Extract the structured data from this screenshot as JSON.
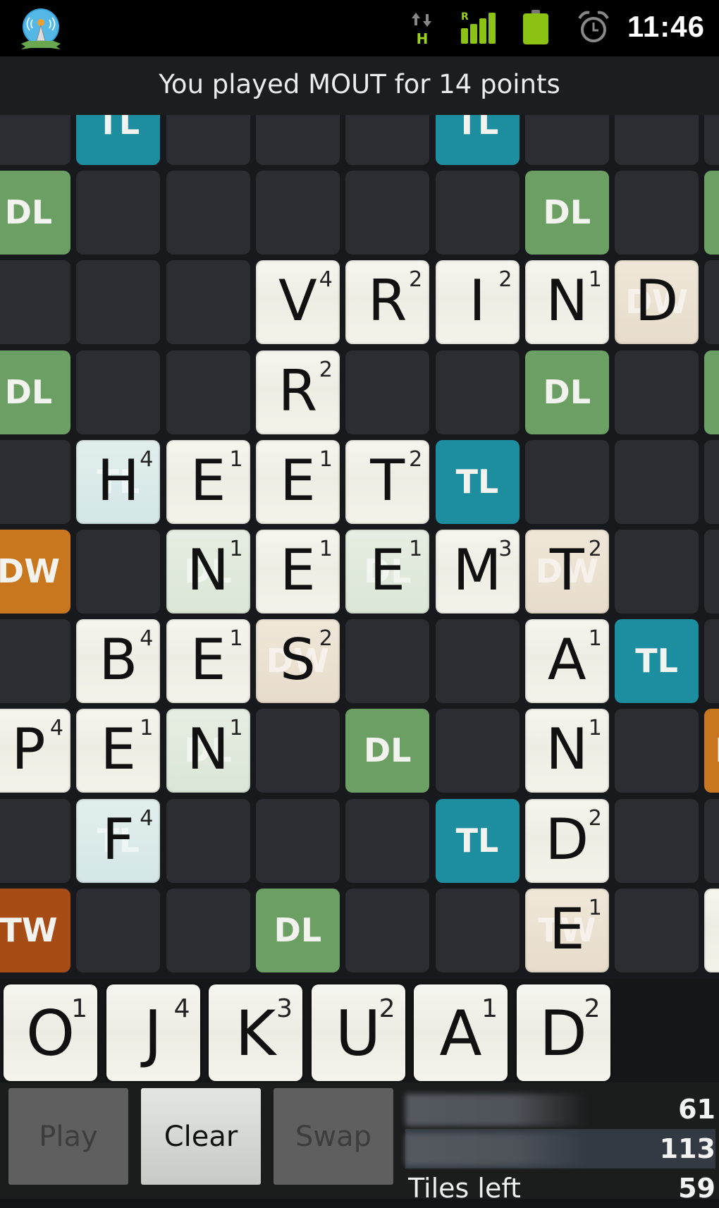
{
  "status_bar": {
    "app_icon": "wifi-tower-pro-icon",
    "network": {
      "icon": "data-arrows-icon",
      "type": "H"
    },
    "signal": {
      "icon": "signal-bars-icon",
      "roaming": "R",
      "level": 4,
      "max": 4
    },
    "battery": {
      "icon": "battery-icon",
      "level_percent": 100
    },
    "alarm_icon": "alarm-clock-icon",
    "time": "11:46"
  },
  "banner": {
    "message": "You played MOUT for 14 points"
  },
  "colors": {
    "TL": "#1c8ea0",
    "DL": "#6c9f63",
    "DW": "#c8771e",
    "TW": "#a84c16",
    "empty": "#2b2d33",
    "tile": "#f3f3eb"
  },
  "board": {
    "visible_rows": 10,
    "visible_cols": 9,
    "rows": [
      [
        {
          "p": ""
        },
        {
          "p": "TL"
        },
        {
          "p": ""
        },
        {
          "p": ""
        },
        {
          "p": ""
        },
        {
          "p": "TL"
        },
        {
          "p": ""
        },
        {
          "p": ""
        },
        {
          "p": ""
        }
      ],
      [
        {
          "p": "DL"
        },
        {
          "p": ""
        },
        {
          "p": ""
        },
        {
          "p": ""
        },
        {
          "p": ""
        },
        {
          "p": ""
        },
        {
          "p": "DL"
        },
        {
          "p": ""
        },
        {
          "p": "DL"
        }
      ],
      [
        {
          "p": ""
        },
        {
          "p": ""
        },
        {
          "p": ""
        },
        {
          "p": "",
          "l": "V",
          "s": "4"
        },
        {
          "p": "",
          "l": "R",
          "s": "2"
        },
        {
          "p": "",
          "l": "I",
          "s": "2"
        },
        {
          "p": "",
          "l": "N",
          "s": "1"
        },
        {
          "p": "DW",
          "l": "D",
          "s": ""
        },
        {
          "p": ""
        }
      ],
      [
        {
          "p": "DL"
        },
        {
          "p": ""
        },
        {
          "p": ""
        },
        {
          "p": "",
          "l": "R",
          "s": "2"
        },
        {
          "p": ""
        },
        {
          "p": ""
        },
        {
          "p": "DL"
        },
        {
          "p": ""
        },
        {
          "p": "DL"
        }
      ],
      [
        {
          "p": ""
        },
        {
          "p": "TL",
          "l": "H",
          "s": "4"
        },
        {
          "p": "",
          "l": "E",
          "s": "1"
        },
        {
          "p": "",
          "l": "E",
          "s": "1"
        },
        {
          "p": "",
          "l": "T",
          "s": "2"
        },
        {
          "p": "TL"
        },
        {
          "p": ""
        },
        {
          "p": ""
        },
        {
          "p": ""
        }
      ],
      [
        {
          "p": "DW"
        },
        {
          "p": ""
        },
        {
          "p": "DL",
          "l": "N",
          "s": "1"
        },
        {
          "p": "",
          "l": "E",
          "s": "1"
        },
        {
          "p": "DL",
          "l": "E",
          "s": "1"
        },
        {
          "p": "",
          "l": "M",
          "s": "3"
        },
        {
          "p": "DW",
          "l": "T",
          "s": "2"
        },
        {
          "p": ""
        },
        {
          "p": ""
        }
      ],
      [
        {
          "p": ""
        },
        {
          "p": "",
          "l": "B",
          "s": "4"
        },
        {
          "p": "",
          "l": "E",
          "s": "1"
        },
        {
          "p": "DW",
          "l": "S",
          "s": "2"
        },
        {
          "p": ""
        },
        {
          "p": ""
        },
        {
          "p": "",
          "l": "A",
          "s": "1"
        },
        {
          "p": "TL"
        },
        {
          "p": ""
        }
      ],
      [
        {
          "p": "",
          "l": "P",
          "s": "4"
        },
        {
          "p": "",
          "l": "E",
          "s": "1"
        },
        {
          "p": "DL",
          "l": "N",
          "s": "1"
        },
        {
          "p": ""
        },
        {
          "p": "DL"
        },
        {
          "p": ""
        },
        {
          "p": "",
          "l": "N",
          "s": "1"
        },
        {
          "p": ""
        },
        {
          "p": "DW"
        }
      ],
      [
        {
          "p": ""
        },
        {
          "p": "TL",
          "l": "F",
          "s": "4"
        },
        {
          "p": ""
        },
        {
          "p": ""
        },
        {
          "p": ""
        },
        {
          "p": "TL"
        },
        {
          "p": "",
          "l": "D",
          "s": "2"
        },
        {
          "p": ""
        },
        {
          "p": ""
        }
      ],
      [
        {
          "p": "TW"
        },
        {
          "p": ""
        },
        {
          "p": ""
        },
        {
          "p": "DL"
        },
        {
          "p": ""
        },
        {
          "p": ""
        },
        {
          "p": "TW",
          "l": "E",
          "s": "1"
        },
        {
          "p": ""
        },
        {
          "p": "",
          "l": "",
          "s": ""
        }
      ]
    ]
  },
  "rack": [
    {
      "letter": "O",
      "score": "1"
    },
    {
      "letter": "J",
      "score": "4"
    },
    {
      "letter": "K",
      "score": "3"
    },
    {
      "letter": "U",
      "score": "2"
    },
    {
      "letter": "A",
      "score": "1"
    },
    {
      "letter": "D",
      "score": "2"
    }
  ],
  "buttons": {
    "play": {
      "label": "Play",
      "enabled": false
    },
    "clear": {
      "label": "Clear",
      "enabled": true
    },
    "swap": {
      "label": "Swap",
      "enabled": false
    }
  },
  "scoreboard": {
    "players": [
      {
        "name": "",
        "score": "61",
        "active": false
      },
      {
        "name": "",
        "score": "113",
        "active": true
      }
    ],
    "tiles_left_label": "Tiles left",
    "tiles_left": "59"
  }
}
